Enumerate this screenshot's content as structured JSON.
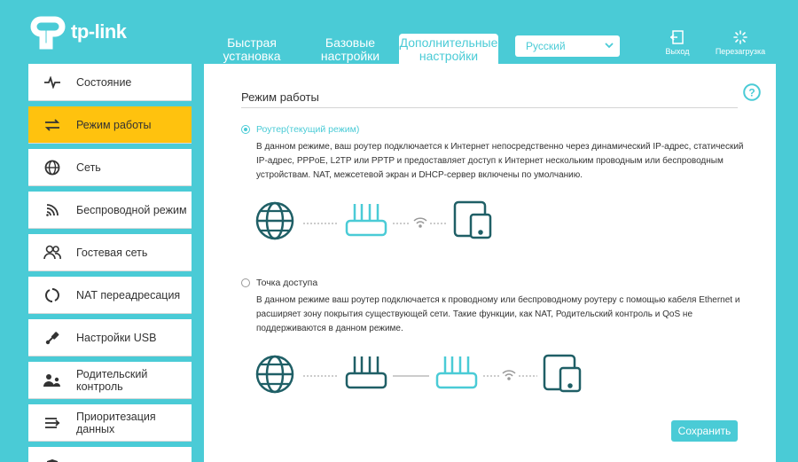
{
  "brand": {
    "name": "tp-link"
  },
  "top_tabs": [
    {
      "line1": "Быстрая",
      "line2": "установка"
    },
    {
      "line1": "Базовые",
      "line2": "настройки"
    },
    {
      "line1": "Дополнительные",
      "line2": "настройки",
      "active": true
    }
  ],
  "language": {
    "selected": "Русский"
  },
  "header_buttons": {
    "logout": "Выход",
    "reboot": "Перезагрузка"
  },
  "sidebar": {
    "items": [
      {
        "line1": "Состояние",
        "line2": "",
        "icon": "pulse-icon"
      },
      {
        "line1": "Режим работы",
        "line2": "",
        "icon": "mode-switch-icon",
        "active": true
      },
      {
        "line1": "Сеть",
        "line2": "",
        "icon": "globe-icon"
      },
      {
        "line1": "Беспроводной режим",
        "line2": "",
        "icon": "wireless-icon"
      },
      {
        "line1": "Гостевая сеть",
        "line2": "",
        "icon": "guest-icon"
      },
      {
        "line1": "NAT переадресация",
        "line2": "",
        "icon": "nat-icon"
      },
      {
        "line1": "Настройки USB",
        "line2": "",
        "icon": "usb-icon"
      },
      {
        "line1": "Родительский",
        "line2": "контроль",
        "icon": "parental-icon"
      },
      {
        "line1": "Приоритезация",
        "line2": "данных",
        "icon": "qos-icon"
      }
    ]
  },
  "main": {
    "title": "Режим работы",
    "router_mode": {
      "label": "Роутер(текущий режим)",
      "description": "В данном режиме, ваш роутер подключается к Интернет непосредственно через динамический IP-адрес, статический IP-адрес, PPPoE, L2TP или PPTP и предоставляет доступ к Интернет нескольким проводным или беспроводным устройствам. NAT, межсетевой экран и DHCP-сервер включены по умолчанию."
    },
    "ap_mode": {
      "label": "Точка доступа",
      "description": "В данном режиме ваш роутер подключается к проводному или беспроводному роутеру с помощью кабеля Ethernet и расширяет зону покрытия существующей сети. Такие функции, как NAT, Родительский контроль и QoS не поддерживаются в данном режиме."
    },
    "save_label": "Сохранить"
  },
  "colors": {
    "accent": "#4acbd6",
    "active_menu": "#ffc20e",
    "icon_dark": "#1f5f66"
  }
}
